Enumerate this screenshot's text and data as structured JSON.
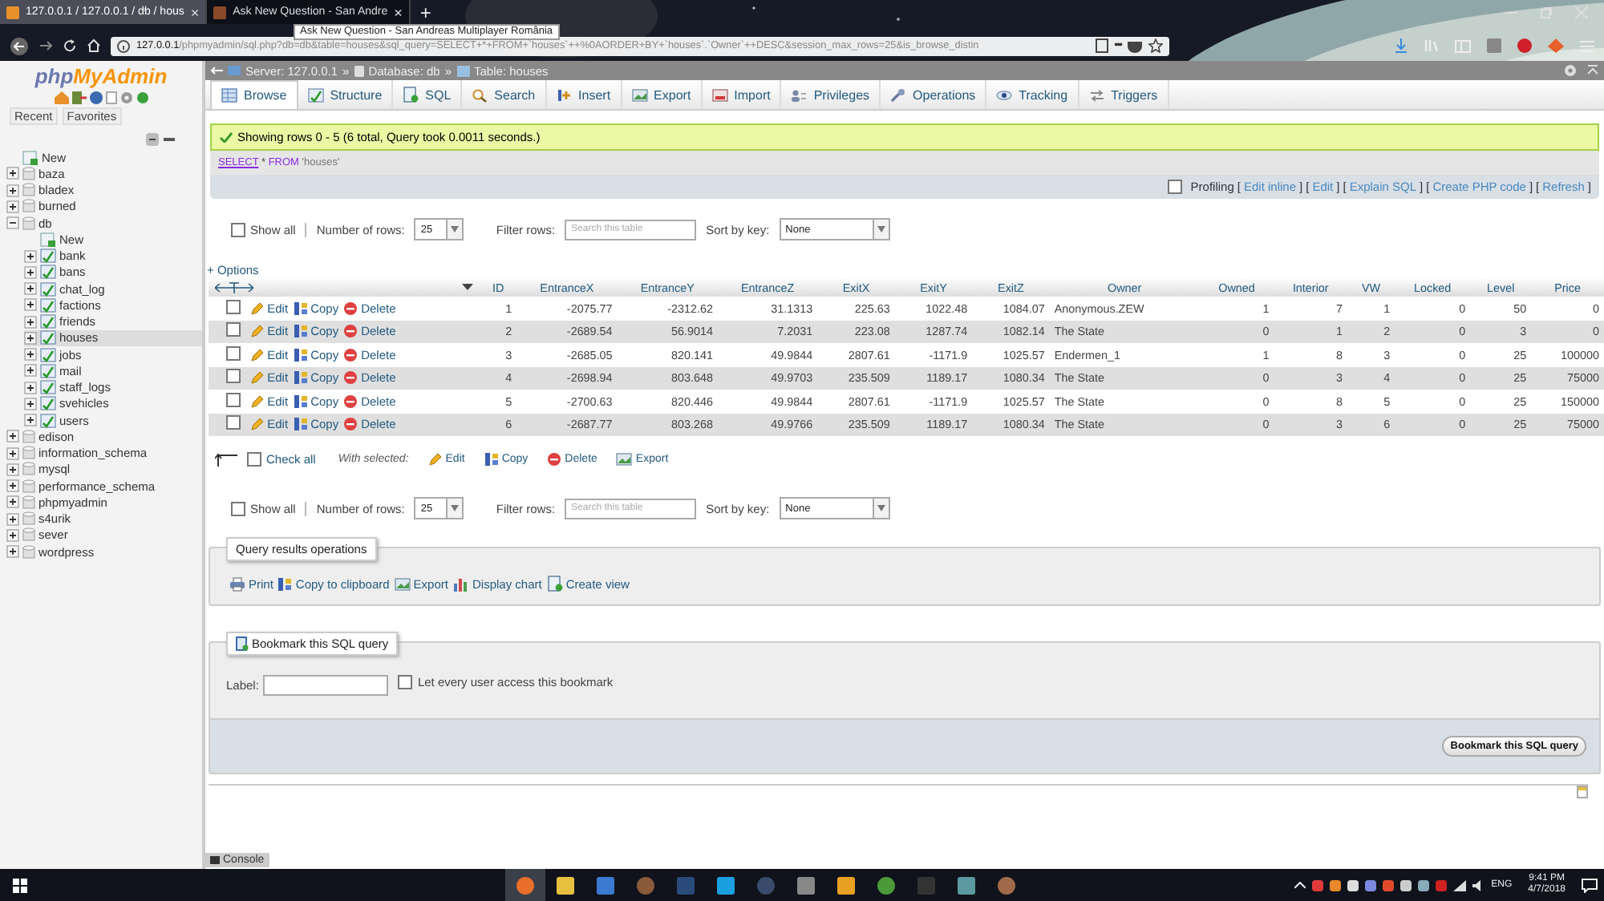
{
  "browser": {
    "tabs": [
      {
        "title": "127.0.0.1 / 127.0.0.1 / db / hous",
        "close": "×",
        "selected": true
      },
      {
        "title": "Ask New Question - San Andre",
        "close": "×",
        "selected": false
      }
    ],
    "new_tab": "+",
    "tooltip": "Ask New Question - San Andreas Multiplayer România",
    "url": {
      "host": "127.0.0.1",
      "path": "/phpmyadmin/sql.php?db=db&table=houses&sql_query=SELECT+*+FROM+`houses`++%0AORDER+BY+`houses`.`Owner`++DESC&session_max_rows=25&is_browse_distin"
    },
    "more": "•••"
  },
  "sidebar": {
    "logo": {
      "php": "php",
      "name": "MyAdmin"
    },
    "nav_tabs": [
      "Recent",
      "Favorites"
    ],
    "tree": [
      {
        "label": "New",
        "kind": "new"
      },
      {
        "label": "baza",
        "kind": "db",
        "expanded": false
      },
      {
        "label": "bladex",
        "kind": "db",
        "expanded": false
      },
      {
        "label": "burned",
        "kind": "db",
        "expanded": false
      },
      {
        "label": "db",
        "kind": "db",
        "expanded": true,
        "children": [
          {
            "label": "New",
            "kind": "new"
          },
          {
            "label": "bank",
            "kind": "table",
            "selected": false
          },
          {
            "label": "bans",
            "kind": "table",
            "selected": false
          },
          {
            "label": "chat_log",
            "kind": "table",
            "selected": false
          },
          {
            "label": "factions",
            "kind": "table",
            "selected": false
          },
          {
            "label": "friends",
            "kind": "table",
            "selected": false
          },
          {
            "label": "houses",
            "kind": "table",
            "selected": true
          },
          {
            "label": "jobs",
            "kind": "table",
            "selected": false
          },
          {
            "label": "mail",
            "kind": "table",
            "selected": false
          },
          {
            "label": "staff_logs",
            "kind": "table",
            "selected": false
          },
          {
            "label": "svehicles",
            "kind": "table",
            "selected": false
          },
          {
            "label": "users",
            "kind": "table",
            "selected": false
          }
        ]
      },
      {
        "label": "edison",
        "kind": "db",
        "expanded": false
      },
      {
        "label": "information_schema",
        "kind": "db",
        "expanded": false
      },
      {
        "label": "mysql",
        "kind": "db",
        "expanded": false
      },
      {
        "label": "performance_schema",
        "kind": "db",
        "expanded": false
      },
      {
        "label": "phpmyadmin",
        "kind": "db",
        "expanded": false
      },
      {
        "label": "s4urik",
        "kind": "db",
        "expanded": false
      },
      {
        "label": "sever",
        "kind": "db",
        "expanded": false
      },
      {
        "label": "wordpress",
        "kind": "db",
        "expanded": false
      }
    ]
  },
  "breadcrumb": [
    "Server: 127.0.0.1",
    "Database: db",
    "Table: houses"
  ],
  "breadcrumb_sep": "»",
  "tabs": [
    {
      "label": "Browse",
      "selected": true
    },
    {
      "label": "Structure",
      "selected": false
    },
    {
      "label": "SQL",
      "selected": false
    },
    {
      "label": "Search",
      "selected": false
    },
    {
      "label": "Insert",
      "selected": false
    },
    {
      "label": "Export",
      "selected": false
    },
    {
      "label": "Import",
      "selected": false
    },
    {
      "label": "Privileges",
      "selected": false
    },
    {
      "label": "Operations",
      "selected": false
    },
    {
      "label": "Tracking",
      "selected": false
    },
    {
      "label": "Triggers",
      "selected": false
    }
  ],
  "message": "Showing rows 0 - 5 (6 total, Query took 0.0011 seconds.)",
  "query": [
    {
      "text": "SELECT",
      "kind": "keyword_link"
    },
    {
      "text": "*",
      "kind": "plain"
    },
    {
      "text": "FROM",
      "kind": "keyword"
    },
    {
      "text": "'houses'",
      "kind": "string"
    }
  ],
  "profiling": {
    "label": "Profiling",
    "checked": false,
    "open": "[",
    "close": "]",
    "links": [
      "Edit inline",
      "Edit",
      "Explain SQL",
      "Create PHP code",
      "Refresh"
    ]
  },
  "navigation": [
    {
      "show_all": {
        "label": "Show all",
        "checked": false
      },
      "rows_label": "Number of rows:",
      "rows_value": "25",
      "filter_label": "Filter rows:",
      "filter_placeholder": "Search this table",
      "sort_label": "Sort by key:",
      "sort_value": "None"
    },
    {
      "show_all": {
        "label": "Show all",
        "checked": false
      },
      "rows_label": "Number of rows:",
      "rows_value": "25",
      "filter_label": "Filter rows:",
      "filter_placeholder": "Search this table",
      "sort_label": "Sort by key:",
      "sort_value": "None"
    }
  ],
  "options_link": "+ Options",
  "table": {
    "columns": [
      {
        "label": "ID",
        "kind": "number"
      },
      {
        "label": "EntranceX",
        "kind": "number"
      },
      {
        "label": "EntranceY",
        "kind": "number"
      },
      {
        "label": "EntranceZ",
        "kind": "number"
      },
      {
        "label": "ExitX",
        "kind": "number"
      },
      {
        "label": "ExitY",
        "kind": "number"
      },
      {
        "label": "ExitZ",
        "kind": "number"
      },
      {
        "label": "Owner",
        "kind": "text"
      },
      {
        "label": "Owned",
        "kind": "number"
      },
      {
        "label": "Interior",
        "kind": "number"
      },
      {
        "label": "VW",
        "kind": "number"
      },
      {
        "label": "Locked",
        "kind": "number"
      },
      {
        "label": "Level",
        "kind": "number"
      },
      {
        "label": "Price",
        "kind": "number"
      }
    ],
    "rows": [
      {
        "checked": false,
        "edit": "Edit",
        "copy": "Copy",
        "delete": "Delete",
        "cells": [
          "1",
          "-2075.77",
          "-2312.62",
          "31.1313",
          "225.63",
          "1022.48",
          "1084.07",
          "Anonymous.ZEW",
          "1",
          "7",
          "1",
          "0",
          "50",
          "0"
        ]
      },
      {
        "checked": false,
        "edit": "Edit",
        "copy": "Copy",
        "delete": "Delete",
        "cells": [
          "2",
          "-2689.54",
          "56.9014",
          "7.2031",
          "223.08",
          "1287.74",
          "1082.14",
          "The State",
          "0",
          "1",
          "2",
          "0",
          "3",
          "0"
        ]
      },
      {
        "checked": false,
        "edit": "Edit",
        "copy": "Copy",
        "delete": "Delete",
        "cells": [
          "3",
          "-2685.05",
          "820.141",
          "49.9844",
          "2807.61",
          "-1171.9",
          "1025.57",
          "Endermen_1",
          "1",
          "8",
          "3",
          "0",
          "25",
          "100000"
        ]
      },
      {
        "checked": false,
        "edit": "Edit",
        "copy": "Copy",
        "delete": "Delete",
        "cells": [
          "4",
          "-2698.94",
          "803.648",
          "49.9703",
          "235.509",
          "1189.17",
          "1080.34",
          "The State",
          "0",
          "3",
          "4",
          "0",
          "25",
          "75000"
        ]
      },
      {
        "checked": false,
        "edit": "Edit",
        "copy": "Copy",
        "delete": "Delete",
        "cells": [
          "5",
          "-2700.63",
          "820.446",
          "49.9844",
          "2807.61",
          "-1171.9",
          "1025.57",
          "The State",
          "0",
          "8",
          "5",
          "0",
          "25",
          "150000"
        ]
      },
      {
        "checked": false,
        "edit": "Edit",
        "copy": "Copy",
        "delete": "Delete",
        "cells": [
          "6",
          "-2687.77",
          "803.268",
          "49.9766",
          "235.509",
          "1189.17",
          "1080.34",
          "The State",
          "0",
          "3",
          "6",
          "0",
          "25",
          "75000"
        ]
      }
    ]
  },
  "bulk": {
    "check_all": {
      "label": "Check all",
      "checked": false
    },
    "with_selected": "With selected:",
    "actions": [
      {
        "label": "Edit",
        "kind": "edit"
      },
      {
        "label": "Copy",
        "kind": "copy"
      },
      {
        "label": "Delete",
        "kind": "delete"
      },
      {
        "label": "Export",
        "kind": "export"
      }
    ]
  },
  "query_ops": {
    "legend": "Query results operations",
    "actions": [
      {
        "label": "Print",
        "kind": "print"
      },
      {
        "label": "Copy to clipboard",
        "kind": "copy"
      },
      {
        "label": "Export",
        "kind": "export"
      },
      {
        "label": "Display chart",
        "kind": "chart"
      },
      {
        "label": "Create view",
        "kind": "view"
      }
    ]
  },
  "bookmark": {
    "legend": "Bookmark this SQL query",
    "label": "Label:",
    "share": {
      "label": "Let every user access this bookmark",
      "checked": false
    },
    "button": "Bookmark this SQL query"
  },
  "console": "Console",
  "taskbar": {
    "language": "ENG",
    "time": "9:41 PM",
    "date": "4/7/2018"
  }
}
